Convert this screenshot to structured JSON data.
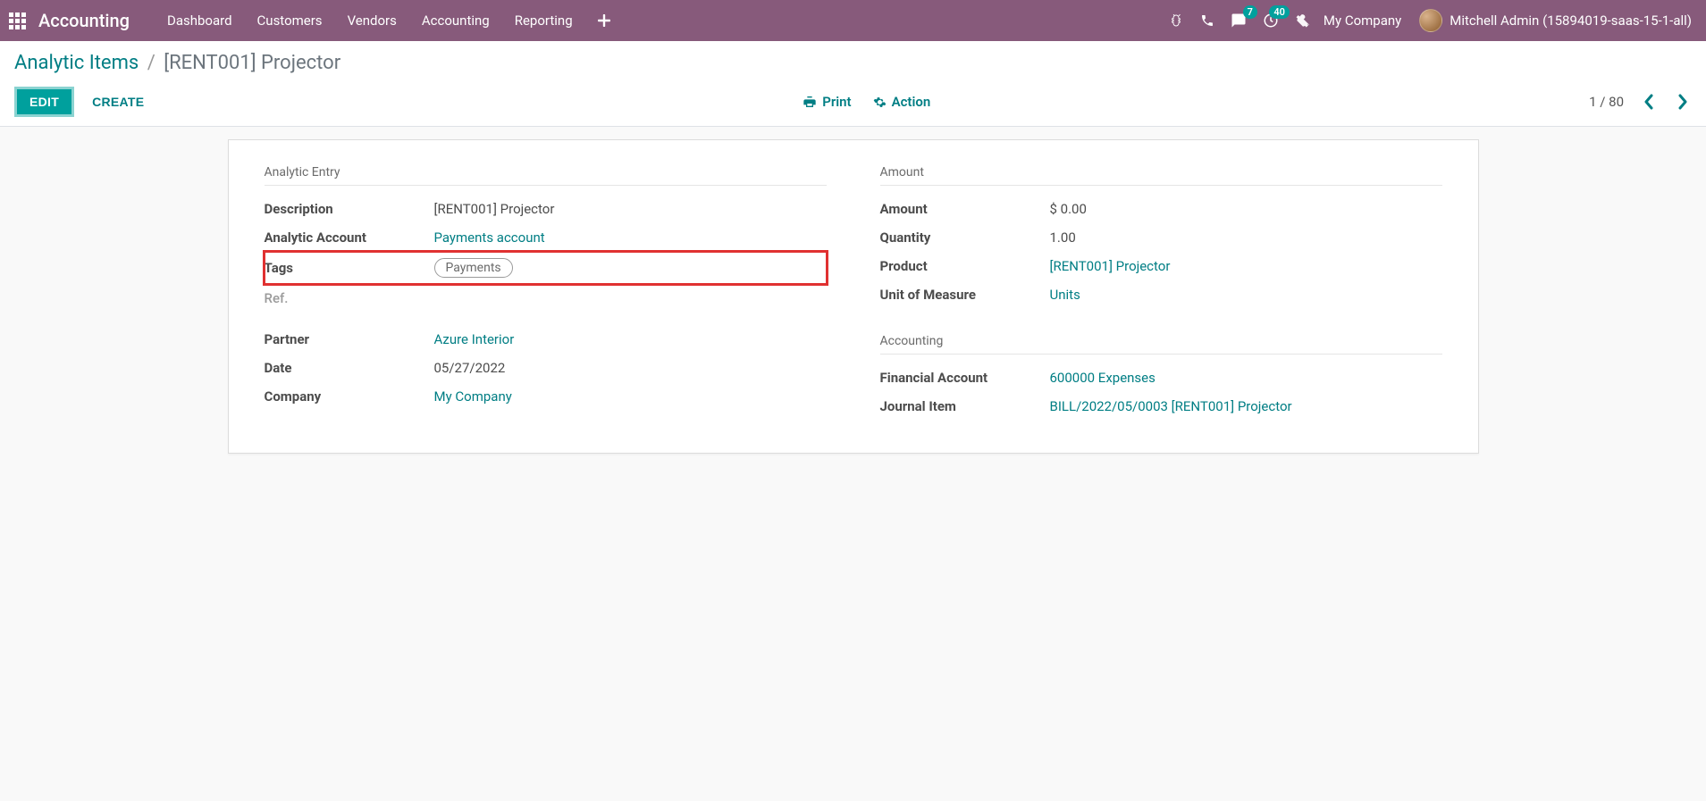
{
  "header": {
    "app_name": "Accounting",
    "nav": [
      "Dashboard",
      "Customers",
      "Vendors",
      "Accounting",
      "Reporting"
    ],
    "messages_badge": "7",
    "activities_badge": "40",
    "company": "My Company",
    "user": "Mitchell Admin (15894019-saas-15-1-all)"
  },
  "breadcrumb": {
    "parent": "Analytic Items",
    "current": "[RENT001] Projector"
  },
  "buttons": {
    "edit": "EDIT",
    "create": "CREATE",
    "print": "Print",
    "action": "Action"
  },
  "pager": {
    "text": "1 / 80"
  },
  "form": {
    "left": {
      "section": "Analytic Entry",
      "description_label": "Description",
      "description_value": "[RENT001] Projector",
      "analytic_account_label": "Analytic Account",
      "analytic_account_value": "Payments account",
      "tags_label": "Tags",
      "tags_value": "Payments",
      "ref_label": "Ref.",
      "partner_label": "Partner",
      "partner_value": "Azure Interior",
      "date_label": "Date",
      "date_value": "05/27/2022",
      "company_label": "Company",
      "company_value": "My Company"
    },
    "right_amount": {
      "section": "Amount",
      "amount_label": "Amount",
      "amount_value": "$ 0.00",
      "quantity_label": "Quantity",
      "quantity_value": "1.00",
      "product_label": "Product",
      "product_value": "[RENT001] Projector",
      "uom_label": "Unit of Measure",
      "uom_value": "Units"
    },
    "right_accounting": {
      "section": "Accounting",
      "fin_account_label": "Financial Account",
      "fin_account_value": "600000 Expenses",
      "journal_item_label": "Journal Item",
      "journal_item_value": "BILL/2022/05/0003 [RENT001] Projector"
    }
  }
}
